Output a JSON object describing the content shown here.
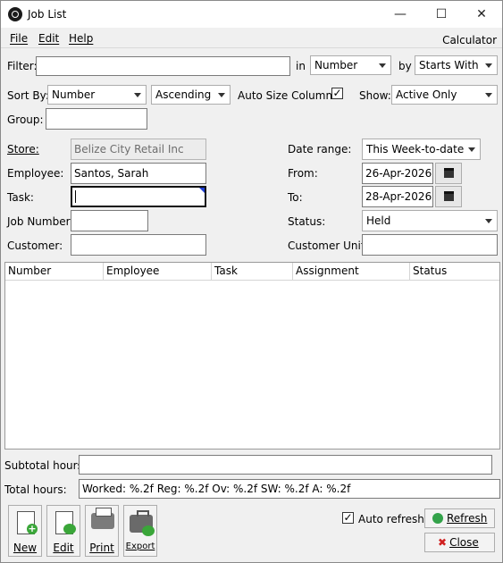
{
  "window": {
    "title": "Job List",
    "minimize": "—",
    "maximize": "☐",
    "close": "✕"
  },
  "menu": {
    "file": "File",
    "edit": "Edit",
    "help": "Help",
    "calculator": "Calculator"
  },
  "filter": {
    "label": "Filter:",
    "value": "",
    "in_label": "in",
    "in_value": "Number",
    "by_label": "by",
    "by_value": "Starts With"
  },
  "sort": {
    "label": "Sort By:",
    "field": "Number",
    "order": "Ascending",
    "auto_size_label": "Auto Size Columns",
    "auto_size_checked": "✓",
    "show_label": "Show:",
    "show_value": "Active Only"
  },
  "group": {
    "label": "Group:",
    "value": ""
  },
  "form": {
    "store_label": "Store:",
    "store_value": "Belize City Retail Inc",
    "employee_label": "Employee:",
    "employee_value": "Santos, Sarah",
    "task_label": "Task:",
    "task_value": "",
    "job_number_label": "Job Number:",
    "job_number_value": "",
    "customer_label": "Customer:",
    "customer_value": "",
    "date_range_label": "Date range:",
    "date_range_value": "This Week-to-date",
    "from_label": "From:",
    "from_value": "26-Apr-2026",
    "to_label": "To:",
    "to_value": "28-Apr-2026",
    "status_label": "Status:",
    "status_value": "Held",
    "customer_unit_label": "Customer Unit:",
    "customer_unit_value": ""
  },
  "table": {
    "columns": [
      "Number",
      "Employee",
      "Task",
      "Assignment",
      "Status"
    ],
    "rows": []
  },
  "totals": {
    "subtotal_label": "Subtotal hours:",
    "subtotal_value": "",
    "total_label": "Total hours:",
    "total_value": "Worked: %.2f  Reg: %.2f  Ov: %.2f  SW: %.2f  A: %.2f"
  },
  "toolbar": {
    "new": "New",
    "edit": "Edit",
    "print": "Print",
    "export": "Export"
  },
  "footer": {
    "auto_refresh_label": "Auto refresh",
    "auto_refresh_checked": "✓",
    "refresh": "Refresh",
    "close": "Close"
  }
}
